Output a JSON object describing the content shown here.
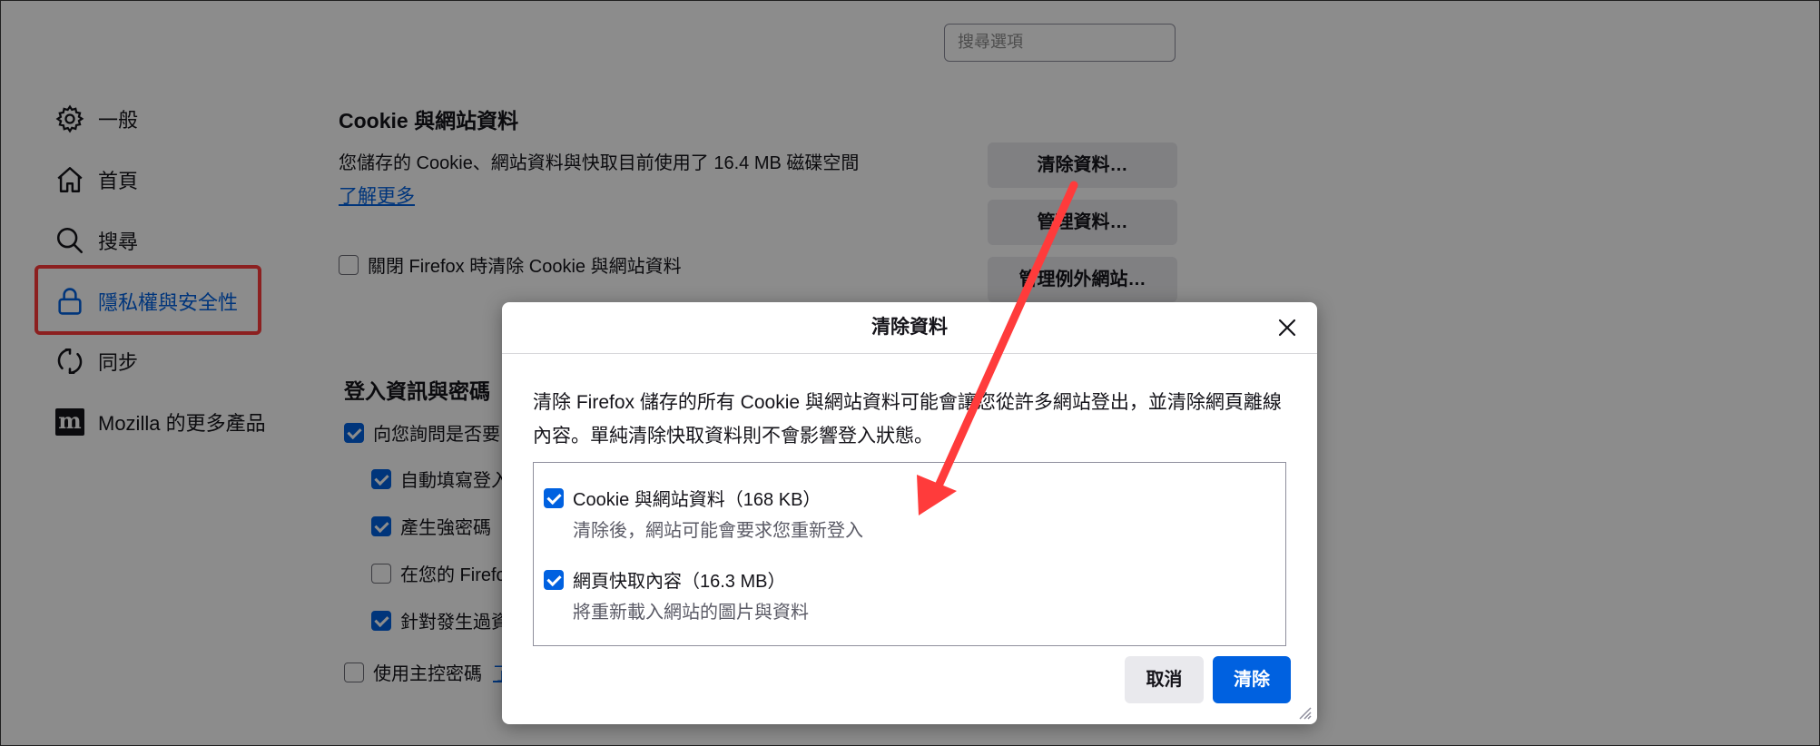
{
  "search": {
    "placeholder": "搜尋選項"
  },
  "sidebar": {
    "items": [
      {
        "label": "一般",
        "icon": "gear-icon"
      },
      {
        "label": "首頁",
        "icon": "home-icon"
      },
      {
        "label": "搜尋",
        "icon": "search-icon"
      },
      {
        "label": "隱私權與安全性",
        "icon": "lock-icon"
      },
      {
        "label": "同步",
        "icon": "sync-icon"
      },
      {
        "label": "Mozilla 的更多產品",
        "icon": "mozilla-logo-icon"
      }
    ],
    "active_color": "#0061e0",
    "highlight_color": "#ff3b3b"
  },
  "cookies": {
    "title": "Cookie 與網站資料",
    "usage": "您儲存的 Cookie、網站資料與快取目前使用了 16.4 MB 磁碟空間",
    "learn_more": "了解更多",
    "clear_on_close": "關閉 Firefox 時清除 Cookie 與網站資料",
    "clear_on_close_checked": false,
    "buttons": {
      "clear_data": "清除資料…",
      "manage_data": "管理資料…",
      "manage_exceptions": "管理例外網站…"
    }
  },
  "logins": {
    "title": "登入資訊與密碼",
    "ask_save": "向您詢問是否要",
    "autofill": "自動填寫登入",
    "generate": "產生強密碼",
    "in_your": "在您的 Firefo",
    "breach": "針對發生過資",
    "primary_password": "使用主控密碼",
    "primary_link": "了"
  },
  "dialog": {
    "title": "清除資料",
    "description": "清除 Firefox 儲存的所有 Cookie 與網站資料可能會讓您從許多網站登出，並清除網頁離線內容。單純清除快取資料則不會影響登入狀態。",
    "options": [
      {
        "label": "Cookie 與網站資料（168 KB）",
        "sub": "清除後，網站可能會要求您重新登入",
        "checked": true
      },
      {
        "label": "網頁快取內容（16.3 MB）",
        "sub": "將重新載入網站的圖片與資料",
        "checked": true
      }
    ],
    "cancel": "取消",
    "clear": "清除",
    "accent": "#0061e0"
  },
  "annotation": {
    "arrow_color": "#ff3b3b"
  }
}
